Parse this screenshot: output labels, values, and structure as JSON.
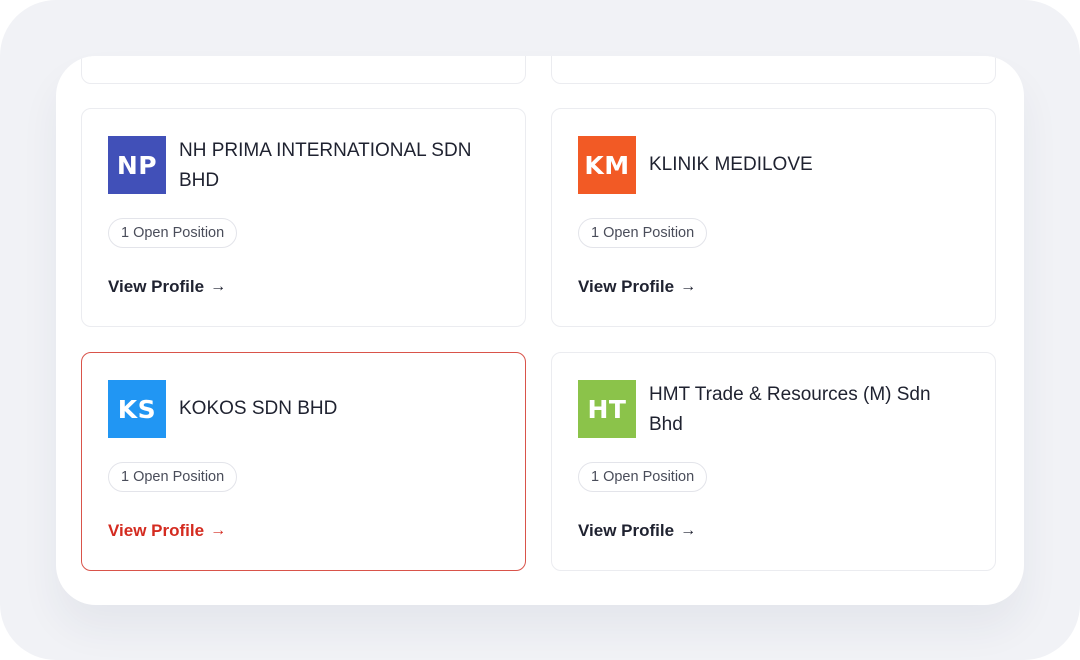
{
  "cards": [
    {
      "initials": "NP",
      "name": "NH PRIMA INTERNATIONAL SDN BHD",
      "logo_color": "#4150b8",
      "open_positions": "1 Open Position",
      "link": "View Profile",
      "arrow": "→"
    },
    {
      "initials": "KM",
      "name": "KLINIK MEDILOVE",
      "logo_color": "#f25a25",
      "open_positions": "1 Open Position",
      "link": "View Profile",
      "arrow": "→"
    },
    {
      "initials": "KS",
      "name": "KOKOS SDN BHD",
      "logo_color": "#2196f3",
      "open_positions": "1 Open Position",
      "link": "View Profile",
      "arrow": "→"
    },
    {
      "initials": "HT",
      "name": "HMT Trade & Resources (M) Sdn Bhd",
      "logo_color": "#8bc34a",
      "open_positions": "1 Open Position",
      "link": "View Profile",
      "arrow": "→"
    }
  ],
  "colors": {
    "highlight_border": "#d9534a",
    "highlight_link": "#d42b20"
  }
}
